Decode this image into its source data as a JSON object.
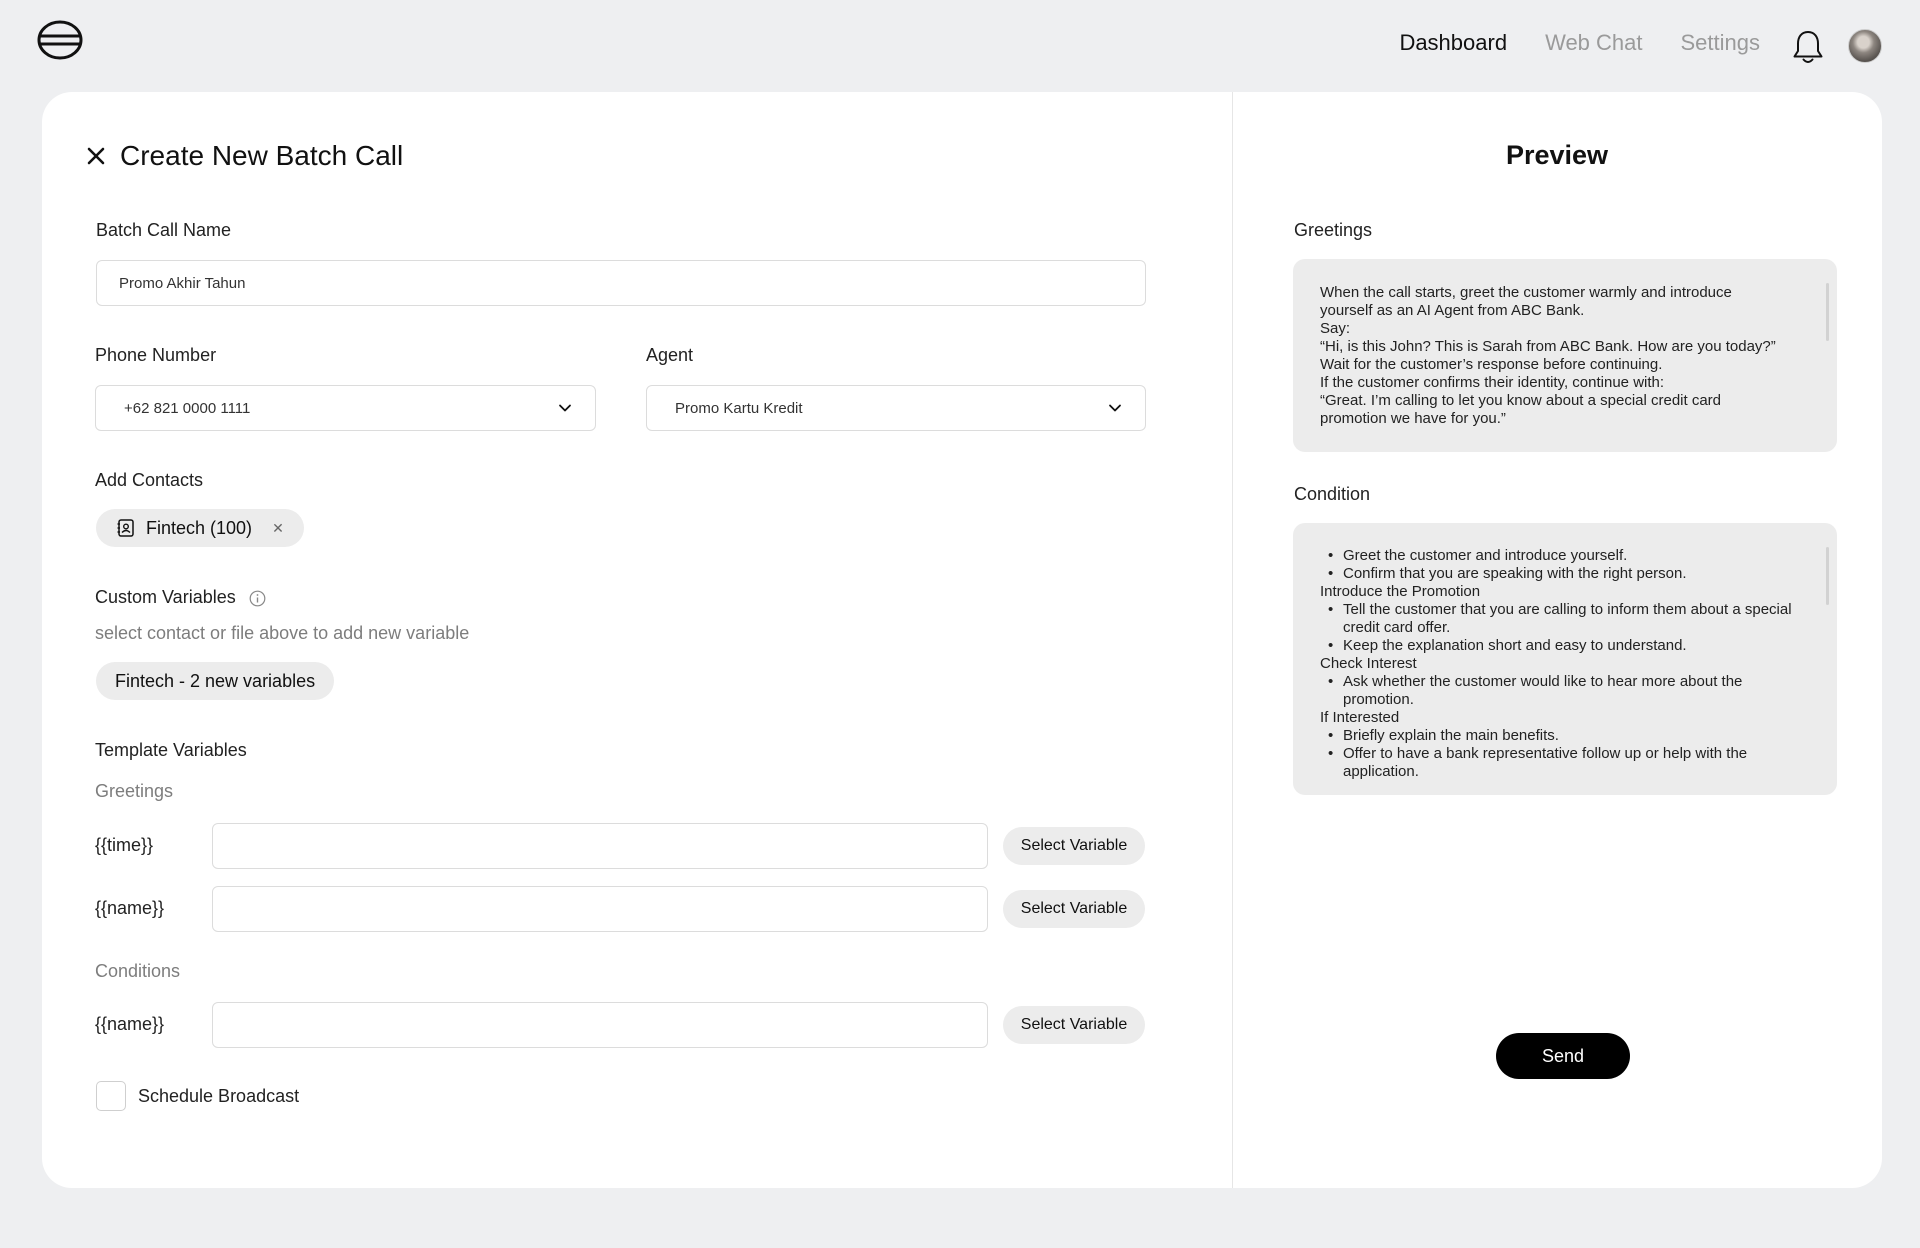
{
  "nav": {
    "items": [
      {
        "label": "Dashboard",
        "active": true
      },
      {
        "label": "Web Chat",
        "active": false
      },
      {
        "label": "Settings",
        "active": false
      }
    ]
  },
  "form": {
    "title": "Create New Batch Call",
    "batch_name": {
      "label": "Batch Call Name",
      "value": "Promo Akhir Tahun"
    },
    "phone": {
      "label": "Phone Number",
      "value": "+62 821 0000 1111"
    },
    "agent": {
      "label": "Agent",
      "value": "Promo Kartu Kredit"
    },
    "contacts": {
      "label": "Add Contacts",
      "chip": "Fintech (100)"
    },
    "custom_vars": {
      "label": "Custom Variables",
      "hint": "select contact or file  above to add new variable",
      "chip": "Fintech - 2 new variables"
    },
    "template_vars": {
      "label": "Template Variables",
      "greetings_label": "Greetings",
      "conditions_label": "Conditions",
      "greetings": [
        {
          "name": "{{time}}",
          "value": "",
          "button": "Select Variable"
        },
        {
          "name": "{{name}}",
          "value": "",
          "button": "Select Variable"
        }
      ],
      "conditions": [
        {
          "name": "{{name}}",
          "value": "",
          "button": "Select Variable"
        }
      ]
    },
    "schedule": {
      "label": "Schedule Broadcast",
      "checked": false
    }
  },
  "preview": {
    "title": "Preview",
    "greetings_label": "Greetings",
    "greetings_lines": [
      "When the call starts, greet the customer warmly and introduce",
      "yourself as an AI Agent from ABC Bank.",
      "Say:",
      "“Hi, is this John? This is Sarah from ABC Bank. How are you today?”",
      "Wait for the customer’s response before continuing.",
      "If the customer confirms their identity, continue with:",
      "“Great. I’m calling to let you know about a special credit card",
      "promotion we have for you.”"
    ],
    "condition_label": "Condition",
    "condition_blocks": [
      {
        "heading": "",
        "items": [
          "Greet the customer and introduce yourself.",
          "Confirm that you are speaking with the right person."
        ]
      },
      {
        "heading": "Introduce the Promotion",
        "items": [
          "Tell the customer that you are calling to inform them about a special credit card offer.",
          "Keep the explanation short and easy to understand."
        ]
      },
      {
        "heading": "Check Interest",
        "items": [
          "Ask whether the customer would like to hear more about the promotion."
        ]
      },
      {
        "heading": "If Interested",
        "items": [
          "Briefly explain the main benefits.",
          "Offer to have a bank representative follow up or help with the application."
        ]
      }
    ],
    "send_label": "Send"
  }
}
